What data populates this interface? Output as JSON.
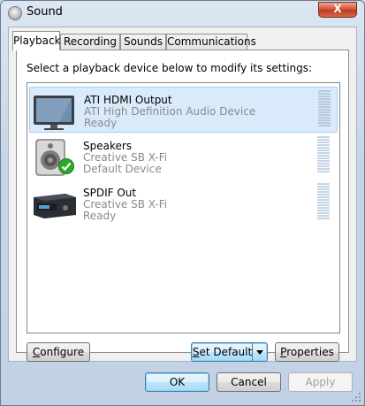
{
  "window": {
    "title": "Sound",
    "close_label": "X"
  },
  "tabs": [
    {
      "label": "Playback",
      "active": true
    },
    {
      "label": "Recording",
      "active": false
    },
    {
      "label": "Sounds",
      "active": false
    },
    {
      "label": "Communications",
      "active": false
    }
  ],
  "playback": {
    "instruction": "Select a playback device below to modify its settings:",
    "devices": [
      {
        "name": "ATI HDMI Output",
        "description": "ATI High Definition Audio Device",
        "status": "Ready",
        "icon": "monitor-icon",
        "selected": true,
        "default": false
      },
      {
        "name": "Speakers",
        "description": "Creative SB X-Fi",
        "status": "Default Device",
        "icon": "speaker-icon",
        "selected": false,
        "default": true
      },
      {
        "name": "SPDIF Out",
        "description": "Creative SB X-Fi",
        "status": "Ready",
        "icon": "spdif-receiver-icon",
        "selected": false,
        "default": false
      }
    ],
    "buttons": {
      "configure": {
        "pre": "",
        "key": "C",
        "post": "onfigure"
      },
      "set_default": {
        "pre": "",
        "key": "S",
        "post": "et Default"
      },
      "properties": {
        "pre": "",
        "key": "P",
        "post": "roperties"
      }
    }
  },
  "dialog_buttons": {
    "ok": "OK",
    "cancel": "Cancel",
    "apply": "Apply"
  },
  "colors": {
    "selection": "#d9ebfb",
    "default_check": "#2fa82f",
    "title_close": "#c23a1e"
  }
}
